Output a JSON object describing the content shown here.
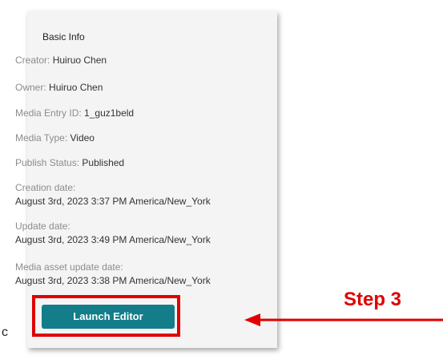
{
  "panel": {
    "title": "Basic Info",
    "fields": [
      {
        "label": "Creator:",
        "value": "Huiruo Chen"
      },
      {
        "label": "Owner:",
        "value": "Huiruo Chen"
      },
      {
        "label": "Media Entry ID:",
        "value": "1_guz1beld"
      },
      {
        "label": "Media Type:",
        "value": "Video"
      },
      {
        "label": "Publish Status:",
        "value": "Published"
      },
      {
        "label": "Creation date:",
        "value": "August 3rd, 2023 3:37 PM America/New_York"
      },
      {
        "label": "Update date:",
        "value": "August 3rd, 2023 3:49 PM America/New_York"
      },
      {
        "label": "Media asset update date:",
        "value": "August 3rd, 2023 3:38 PM America/New_York"
      }
    ],
    "launch_button_label": "Launch Editor"
  },
  "annotation": {
    "step_label": "Step 3",
    "color": "#e00000"
  },
  "stray_text": "c",
  "colors": {
    "button": "#137d8a",
    "panel_bg": "#f4f4f4"
  }
}
